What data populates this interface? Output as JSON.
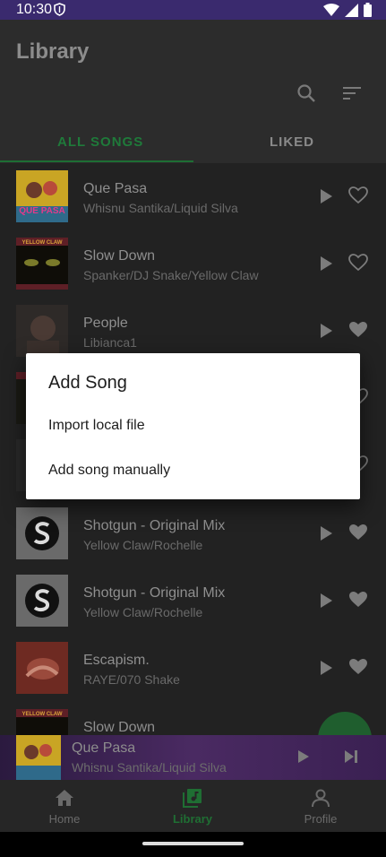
{
  "status_bar": {
    "time": "10:30"
  },
  "header": {
    "title": "Library",
    "tabs": [
      {
        "label": "ALL SONGS",
        "selected": true
      },
      {
        "label": "LIKED",
        "selected": false
      }
    ]
  },
  "songs": [
    {
      "title": "Que Pasa",
      "artist": "Whisnu Santika/Liquid Silva",
      "liked": false
    },
    {
      "title": "Slow Down",
      "artist": "Spanker/DJ Snake/Yellow Claw",
      "liked": false
    },
    {
      "title": "People",
      "artist": "Libianca1",
      "liked": true
    },
    {
      "title": "",
      "artist": "",
      "liked": false
    },
    {
      "title": "",
      "artist": "",
      "liked": false
    },
    {
      "title": "Shotgun - Original Mix",
      "artist": "Yellow Claw/Rochelle",
      "liked": true
    },
    {
      "title": "Shotgun - Original Mix",
      "artist": "Yellow Claw/Rochelle",
      "liked": true
    },
    {
      "title": "Escapism.",
      "artist": "RAYE/070 Shake",
      "liked": true
    },
    {
      "title": "Slow Down",
      "artist": "",
      "liked": false
    }
  ],
  "album_art_text": {
    "yellow_claw": "YELLOW CLAW",
    "que_pasa": "QUE PASA"
  },
  "mini_player": {
    "title": "Que Pasa",
    "artist": "Whisnu Santika/Liquid Silva"
  },
  "bottom_nav": [
    {
      "label": "Home",
      "icon": "home-icon"
    },
    {
      "label": "Library",
      "icon": "library-music-icon"
    },
    {
      "label": "Profile",
      "icon": "person-icon"
    }
  ],
  "dialog": {
    "title": "Add Song",
    "options": [
      "Import local file",
      "Add song manually"
    ]
  },
  "colors": {
    "accent": "#1f7a3a",
    "status_bar": "#3a2a6e",
    "fab": "#1f5e2e"
  }
}
